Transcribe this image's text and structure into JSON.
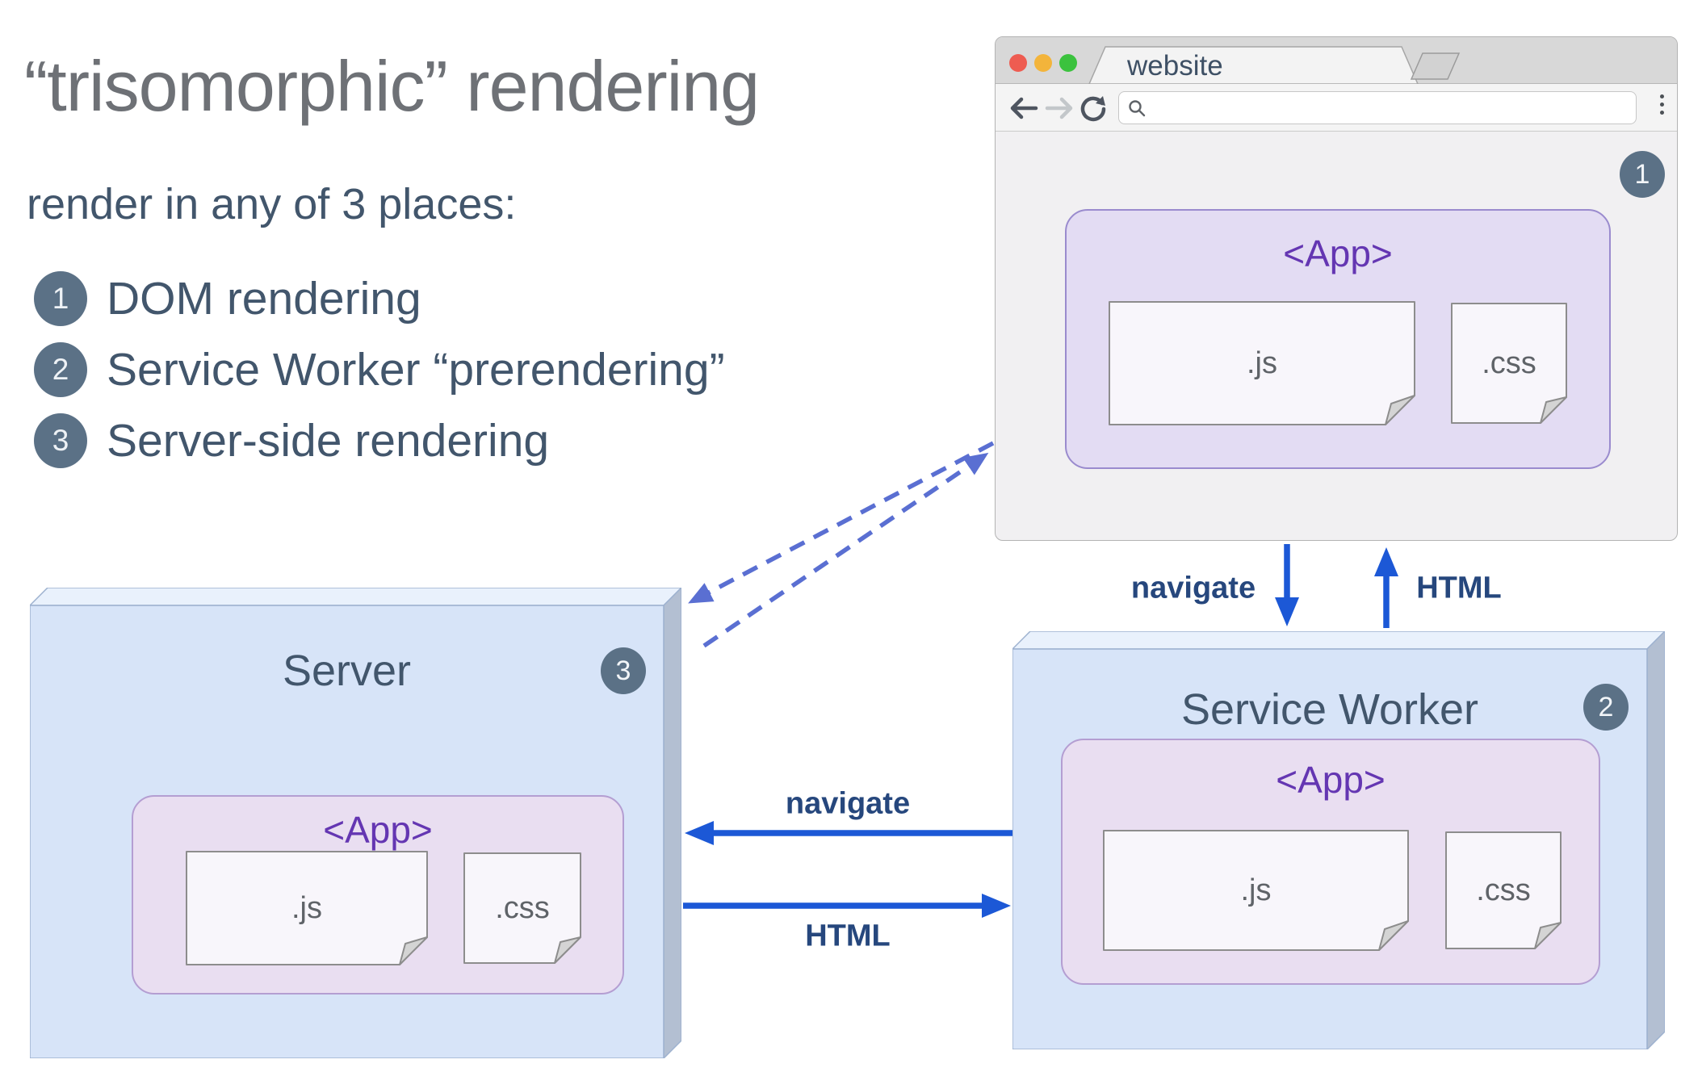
{
  "colors": {
    "title_gray": "#6e7176",
    "text_slate": "#42566c",
    "badge_slate": "#5b7186",
    "app_purple": "#6436b2",
    "arrow_blue": "#1c58d6",
    "arrow_label_navy": "#26477d",
    "dashed_periwinkle": "#5a6fd2",
    "box_front_blue": "#d7e4f8",
    "app_box_lavender": "#e9def1"
  },
  "header": {
    "title": "“trisomorphic” rendering",
    "subtitle": "render in any of 3 places:"
  },
  "legend": {
    "items": [
      {
        "num": "1",
        "label": "DOM rendering"
      },
      {
        "num": "2",
        "label": "Service Worker “prerendering”"
      },
      {
        "num": "3",
        "label": "Server-side rendering"
      }
    ]
  },
  "browser": {
    "tab_title": "website",
    "badge": "1",
    "app": {
      "title": "<App>",
      "js": ".js",
      "css": ".css"
    }
  },
  "service_worker": {
    "title": "Service Worker",
    "badge": "2",
    "app": {
      "title": "<App>",
      "js": ".js",
      "css": ".css"
    }
  },
  "server": {
    "title": "Server",
    "badge": "3",
    "app": {
      "title": "<App>",
      "js": ".js",
      "css": ".css"
    }
  },
  "arrows": {
    "browser_sw": {
      "request": "navigate",
      "response": "HTML"
    },
    "server_sw": {
      "request": "navigate",
      "response": "HTML"
    }
  }
}
